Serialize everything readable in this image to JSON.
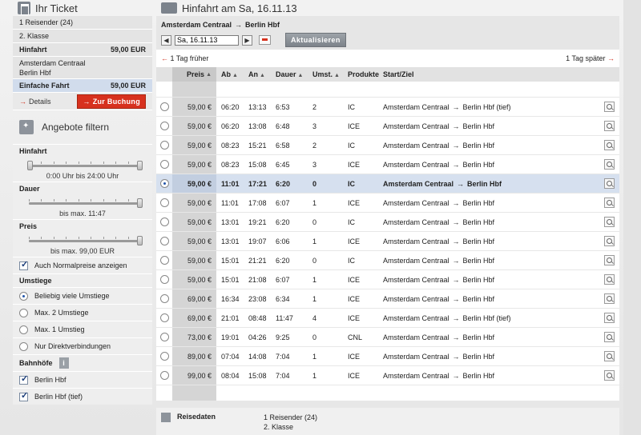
{
  "ticket": {
    "title": "Ihr Ticket",
    "travellers": "1 Reisender (24)",
    "class": "2. Klasse",
    "outbound_label": "Hinfahrt",
    "outbound_price": "59,00 EUR",
    "from": "Amsterdam Centraal",
    "to": "Berlin Hbf",
    "fare_label": "Einfache Fahrt",
    "fare_price": "59,00 EUR",
    "details_label": "Details",
    "book_label": "Zur Buchung"
  },
  "filter": {
    "title": "Angebote filtern",
    "outbound_label": "Hinfahrt",
    "outbound_value": "0:00 Uhr bis 24:00 Uhr",
    "duration_label": "Dauer",
    "duration_value": "bis max. 11:47",
    "price_label": "Preis",
    "price_value": "bis max. 99,00 EUR",
    "normal_prices_label": "Auch Normalpreise anzeigen",
    "transfers_label": "Umstiege",
    "transfers_options": [
      "Beliebig viele Umstiege",
      "Max. 2 Umstiege",
      "Max. 1 Umstieg",
      "Nur Direktverbindungen"
    ],
    "stations_label": "Bahnhöfe",
    "stations": [
      "Berlin Hbf",
      "Berlin Hbf (tief)"
    ]
  },
  "main": {
    "title": "Hinfahrt am  Sa, 16.11.13",
    "route_from": "Amsterdam Centraal",
    "route_to": "Berlin Hbf",
    "date_value": "Sa, 16.11.13",
    "update_label": "Aktualisieren",
    "earlier_label": "1 Tag früher",
    "later_label": "1 Tag später",
    "columns": {
      "preis": "Preis",
      "ab": "Ab",
      "an": "An",
      "dauer": "Dauer",
      "umst": "Umst.",
      "produkte": "Produkte",
      "start_ziel": "Start/Ziel"
    },
    "rows": [
      {
        "preis": "59,00 €",
        "ab": "06:20",
        "an": "13:13",
        "dauer": "6:53",
        "umst": "2",
        "prod": "IC",
        "from": "Amsterdam Centraal",
        "to": "Berlin Hbf (tief)"
      },
      {
        "preis": "59,00 €",
        "ab": "06:20",
        "an": "13:08",
        "dauer": "6:48",
        "umst": "3",
        "prod": "ICE",
        "from": "Amsterdam Centraal",
        "to": "Berlin Hbf"
      },
      {
        "preis": "59,00 €",
        "ab": "08:23",
        "an": "15:21",
        "dauer": "6:58",
        "umst": "2",
        "prod": "IC",
        "from": "Amsterdam Centraal",
        "to": "Berlin Hbf"
      },
      {
        "preis": "59,00 €",
        "ab": "08:23",
        "an": "15:08",
        "dauer": "6:45",
        "umst": "3",
        "prod": "ICE",
        "from": "Amsterdam Centraal",
        "to": "Berlin Hbf"
      },
      {
        "preis": "59,00 €",
        "ab": "11:01",
        "an": "17:21",
        "dauer": "6:20",
        "umst": "0",
        "prod": "IC",
        "from": "Amsterdam Centraal",
        "to": "Berlin Hbf"
      },
      {
        "preis": "59,00 €",
        "ab": "11:01",
        "an": "17:08",
        "dauer": "6:07",
        "umst": "1",
        "prod": "ICE",
        "from": "Amsterdam Centraal",
        "to": "Berlin Hbf"
      },
      {
        "preis": "59,00 €",
        "ab": "13:01",
        "an": "19:21",
        "dauer": "6:20",
        "umst": "0",
        "prod": "IC",
        "from": "Amsterdam Centraal",
        "to": "Berlin Hbf"
      },
      {
        "preis": "59,00 €",
        "ab": "13:01",
        "an": "19:07",
        "dauer": "6:06",
        "umst": "1",
        "prod": "ICE",
        "from": "Amsterdam Centraal",
        "to": "Berlin Hbf"
      },
      {
        "preis": "59,00 €",
        "ab": "15:01",
        "an": "21:21",
        "dauer": "6:20",
        "umst": "0",
        "prod": "IC",
        "from": "Amsterdam Centraal",
        "to": "Berlin Hbf"
      },
      {
        "preis": "59,00 €",
        "ab": "15:01",
        "an": "21:08",
        "dauer": "6:07",
        "umst": "1",
        "prod": "ICE",
        "from": "Amsterdam Centraal",
        "to": "Berlin Hbf"
      },
      {
        "preis": "69,00 €",
        "ab": "16:34",
        "an": "23:08",
        "dauer": "6:34",
        "umst": "1",
        "prod": "ICE",
        "from": "Amsterdam Centraal",
        "to": "Berlin Hbf"
      },
      {
        "preis": "69,00 €",
        "ab": "21:01",
        "an": "08:48",
        "dauer": "11:47",
        "umst": "4",
        "prod": "ICE",
        "from": "Amsterdam Centraal",
        "to": "Berlin Hbf (tief)"
      },
      {
        "preis": "73,00 €",
        "ab": "19:01",
        "an": "04:26",
        "dauer": "9:25",
        "umst": "0",
        "prod": "CNL",
        "from": "Amsterdam Centraal",
        "to": "Berlin Hbf"
      },
      {
        "preis": "89,00 €",
        "ab": "07:04",
        "an": "14:08",
        "dauer": "7:04",
        "umst": "1",
        "prod": "ICE",
        "from": "Amsterdam Centraal",
        "to": "Berlin Hbf"
      },
      {
        "preis": "99,00 €",
        "ab": "08:04",
        "an": "15:08",
        "dauer": "7:04",
        "umst": "1",
        "prod": "ICE",
        "from": "Amsterdam Centraal",
        "to": "Berlin Hbf"
      }
    ],
    "selected_row": 4,
    "reise_label": "Reisedaten",
    "reise_line1": "1 Reisender (24)",
    "reise_line2": "2. Klasse"
  }
}
